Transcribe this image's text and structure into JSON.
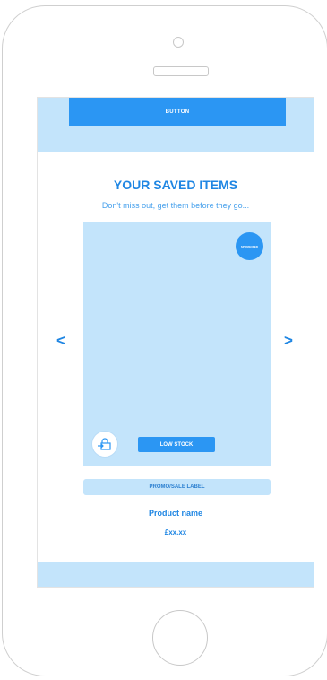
{
  "header": {
    "button_label": "BUTTON"
  },
  "saved_items": {
    "title": "YOUR SAVED ITEMS",
    "subtitle": "Don't miss out, get them before they go..."
  },
  "carousel": {
    "prev_icon": "chevron-left-icon",
    "next_icon": "chevron-right-icon",
    "prev_glyph": "<",
    "next_glyph": ">"
  },
  "product": {
    "sponsor_badge": "SPONSORED",
    "basket_icon": "add-to-basket-icon",
    "stock_label": "LOW STOCK",
    "promo_label": "PROMO/SALE LABEL",
    "name": "Product name",
    "price": "£xx.xx"
  },
  "colors": {
    "primary": "#2b96f3",
    "text_accent": "#1f86e3",
    "light_band": "#c3e4fb"
  }
}
